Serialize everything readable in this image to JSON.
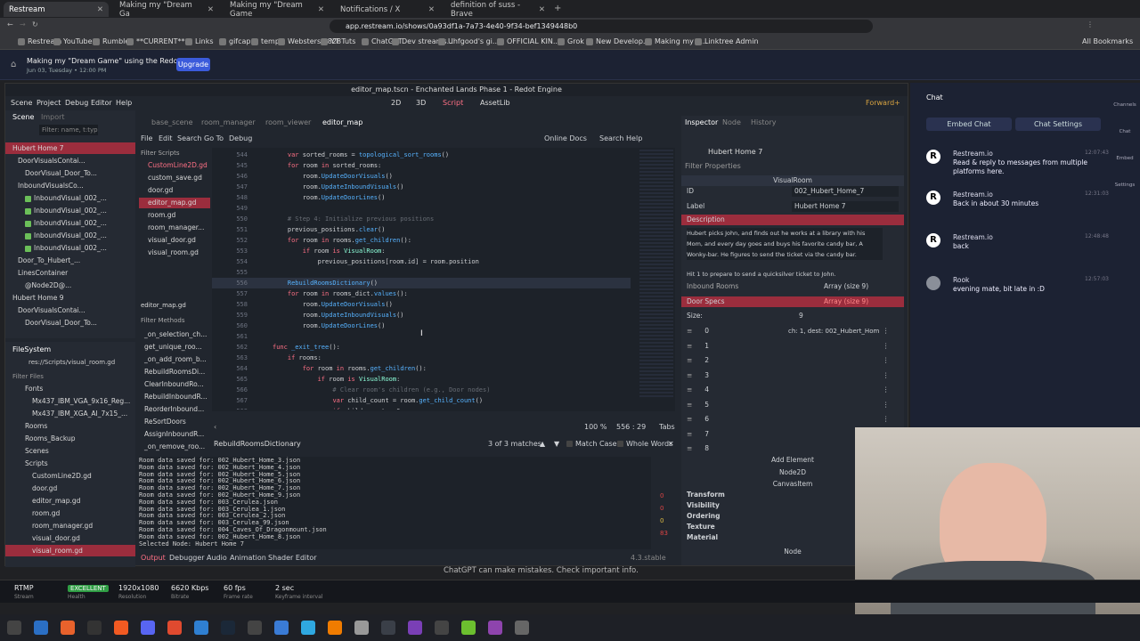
{
  "browser": {
    "tabs": [
      {
        "label": "Restream",
        "active": true
      },
      {
        "label": "Making my \"Dream Ga",
        "active": false
      },
      {
        "label": "Making my \"Dream Game",
        "active": false
      },
      {
        "label": "Notifications / X",
        "active": false
      },
      {
        "label": "definition of suss - Brave",
        "active": false
      }
    ],
    "url": "app.restream.io/shows/0a93df1a-7a73-4e40-9f34-bef1349448b0",
    "bookmarks": [
      "Restream",
      "YouTube",
      "Rumble",
      "**CURRENT**",
      "Links",
      "gifcap",
      "temp",
      "Websters 1828",
      "YT Tuts",
      "ChatGPT",
      "Dev streams...",
      "Uhfgood's gi...",
      "OFFICIAL KIN...",
      "Grok",
      "New Develop...",
      "Making my d...",
      "Linktree Admin"
    ],
    "all_bookmarks": "All Bookmarks"
  },
  "restream": {
    "show_title": "Making my \"Dream Game\" using the Redo...",
    "show_date": "Jun 03, Tuesday • 12:00 PM",
    "upgrade_label": "Upgrade",
    "chat_label": "Chat",
    "embed_chat": "Embed Chat",
    "chat_settings": "Chat Settings",
    "side_icons": [
      "Channels",
      "Chat",
      "Embed",
      "Settings"
    ],
    "messages": [
      {
        "user": "Restream.io",
        "time": "12:07:43",
        "text": "Read & reply to messages from multiple platforms here."
      },
      {
        "user": "Restream.io",
        "time": "12:31:03",
        "text": "Back in about 30 minutes"
      },
      {
        "user": "Restream.io",
        "time": "12:48:48",
        "text": "back"
      },
      {
        "user": "Rook",
        "time": "12:57:03",
        "text": "evening mate, bit late in :D"
      }
    ],
    "chatgpt_note": "ChatGPT can make mistakes. Check important info."
  },
  "godot": {
    "window_title": "editor_map.tscn - Enchanted Lands Phase 1 - Redot Engine",
    "menu": [
      "Scene",
      "Project",
      "Debug",
      "Editor",
      "Help"
    ],
    "workspaces": [
      "2D",
      "3D",
      "Script",
      "AssetLib"
    ],
    "renderer": "Forward+",
    "scene_tabs": [
      "Scene",
      "Import"
    ],
    "scene_tree": [
      "Hubert Home 7",
      "DoorVisualsContai...",
      "DoorVisual_Door_To...",
      "InboundVisualsCo...",
      "InboundVisual_002_...",
      "InboundVisual_002_...",
      "InboundVisual_002_...",
      "InboundVisual_002_...",
      "InboundVisual_002_...",
      "Door_To_Hubert_...",
      "LinesContainer",
      "@Node2D@...",
      "Hubert Home 9",
      "DoorVisualsContai...",
      "DoorVisual_Door_To..."
    ],
    "filter_placeholder": "Filter: name, t:typ",
    "filesystem_label": "FileSystem",
    "fs_path": "res://Scripts/visual_room.gd",
    "filter_files": "Filter Files",
    "fs_items": [
      "Fonts",
      "Mx437_IBM_VGA_9x16_Reg...",
      "Mx437_IBM_XGA_AI_7x15_...",
      "Rooms",
      "Rooms_Backup",
      "Scenes",
      "Scripts",
      "CustomLine2D.gd",
      "door.gd",
      "editor_map.gd",
      "room.gd",
      "room_manager.gd",
      "visual_door.gd",
      "visual_room.gd"
    ],
    "doc_tabs": [
      "base_scene",
      "room_manager",
      "room_viewer",
      "editor_map"
    ],
    "script_menu": [
      "File",
      "Edit",
      "Search",
      "Go To",
      "Debug"
    ],
    "online_docs": "Online Docs",
    "search_help": "Search Help",
    "filter_scripts": "Filter Scripts",
    "scripts": [
      "CustomLine2D.gd",
      "custom_save.gd",
      "door.gd",
      "editor_map.gd",
      "room.gd",
      "room_manager...",
      "visual_door.gd",
      "visual_room.gd"
    ],
    "current_script": "editor_map.gd",
    "filter_methods": "Filter Methods",
    "methods": [
      "_on_selection_ch...",
      "get_unique_roo...",
      "_on_add_room_b...",
      "RebuildRoomsDi...",
      "ClearInboundRo...",
      "RebuildInboundR...",
      "ReorderInbound...",
      "ReSortDoors",
      "AssignInboundR...",
      "_on_remove_roo..."
    ],
    "code": [
      {
        "n": "544",
        "t": "\tvar sorted_rooms = topological_sort_rooms()"
      },
      {
        "n": "545",
        "t": "\tfor room in sorted_rooms:"
      },
      {
        "n": "546",
        "t": "\t\troom.UpdateDoorVisuals()"
      },
      {
        "n": "547",
        "t": "\t\troom.UpdateInboundVisuals()"
      },
      {
        "n": "548",
        "t": "\t\troom.UpdateDoorLines()"
      },
      {
        "n": "549",
        "t": ""
      },
      {
        "n": "550",
        "t": "\t# Step 4: Initialize previous positions"
      },
      {
        "n": "551",
        "t": "\tprevious_positions.clear()"
      },
      {
        "n": "552",
        "t": "\tfor room in rooms.get_children():"
      },
      {
        "n": "553",
        "t": "\t\tif room is VisualRoom:"
      },
      {
        "n": "554",
        "t": "\t\t\tprevious_positions[room.id] = room.position"
      },
      {
        "n": "555",
        "t": ""
      },
      {
        "n": "556",
        "t": "\tRebuildRoomsDictionary()"
      },
      {
        "n": "557",
        "t": "\tfor room in rooms_dict.values():"
      },
      {
        "n": "558",
        "t": "\t\troom.UpdateDoorVisuals()"
      },
      {
        "n": "559",
        "t": "\t\troom.UpdateInboundVisuals()"
      },
      {
        "n": "560",
        "t": "\t\troom.UpdateDoorLines()"
      },
      {
        "n": "561",
        "t": ""
      },
      {
        "n": "562",
        "t": "func _exit_tree():"
      },
      {
        "n": "563",
        "t": "\tif rooms:"
      },
      {
        "n": "564",
        "t": "\t\tfor room in rooms.get_children():"
      },
      {
        "n": "565",
        "t": "\t\t\tif room is VisualRoom:"
      },
      {
        "n": "566",
        "t": "\t\t\t\t# Clear room's children (e.g., Door nodes)"
      },
      {
        "n": "567",
        "t": "\t\t\t\tvar child_count = room.get_child_count()"
      },
      {
        "n": "568",
        "t": "\t\t\t\tif child_count > 0:"
      }
    ],
    "zoom": "100 %",
    "cursor": "556 :  29",
    "tabs_label": "Tabs",
    "search_text": "RebuildRoomsDictionary",
    "matches": "3 of 3 matches",
    "match_case": "Match Case",
    "whole_words": "Whole Words",
    "output": [
      "Room data saved for: 002_Hubert_Home_3.json",
      "Room data saved for: 002_Hubert_Home_4.json",
      "Room data saved for: 002_Hubert_Home_5.json",
      "Room data saved for: 002_Hubert_Home_6.json",
      "Room data saved for: 002_Hubert_Home_7.json",
      "Room data saved for: 002_Hubert_Home_9.json",
      "Room data saved for: 003_Cerulea.json",
      "Room data saved for: 003_Cerulea_1.json",
      "Room data saved for: 003_Cerulea_2.json",
      "Room data saved for: 003_Cerulea_99.json",
      "Room data saved for: 004_Caves_Of_Dragonmount.json",
      "Room data saved for: 002_Hubert_Home_8.json",
      "Selected Node: Hubert Home 7"
    ],
    "bottom_tabs": [
      "Output",
      "Debugger",
      "Audio",
      "Animation",
      "Shader Editor"
    ],
    "version": "4.3.stable",
    "out_counts": [
      "0",
      "0",
      "0",
      "83"
    ],
    "inspector_tabs": [
      "Inspector",
      "Node",
      "History"
    ],
    "inspector_node": "Hubert Home 7",
    "filter_properties": "Filter Properties",
    "class_name": "VisualRoom",
    "id_label": "ID",
    "id_value": "002_Hubert_Home_7",
    "label_label": "Label",
    "label_value": "Hubert Home 7",
    "description_label": "Description",
    "description": "Hubert picks John, and finds out he works at a library with his Mom, and every day goes and buys his favorite candy bar, A Wonky-bar. He figures to send the ticket via the candy bar.",
    "description_tail": "Hit 1 to prepare to send a quicksilver ticket to John.",
    "inbound_label": "Inbound Rooms",
    "inbound_value": "Array (size 9)",
    "door_specs_label": "Door Specs",
    "door_specs_value": "Array (size 9)",
    "size_label": "Size:",
    "size_value": "9",
    "array_first": "ch: 1, dest: 002_Hubert_Hom",
    "array_indices": [
      "0",
      "1",
      "2",
      "3",
      "4",
      "5",
      "6",
      "7",
      "8"
    ],
    "add_element": "Add Element",
    "node2d": "Node2D",
    "canvas_item": "CanvasItem",
    "groups": [
      "Transform",
      "Visibility",
      "Ordering",
      "Texture",
      "Material"
    ],
    "node_label": "Node"
  },
  "status": [
    {
      "value": "RTMP",
      "label": "Stream"
    },
    {
      "value": "EXCELLENT",
      "label": "Health"
    },
    {
      "value": "1920x1080",
      "label": "Resolution"
    },
    {
      "value": "6620 Kbps",
      "label": "Bitrate"
    },
    {
      "value": "60 fps",
      "label": "Frame rate"
    },
    {
      "value": "2 sec",
      "label": "Keyframe interval"
    }
  ],
  "colors": {
    "accent": "#3b5bdb",
    "godot_red": "#9b2d3d",
    "excellent": "#2f9e44"
  }
}
